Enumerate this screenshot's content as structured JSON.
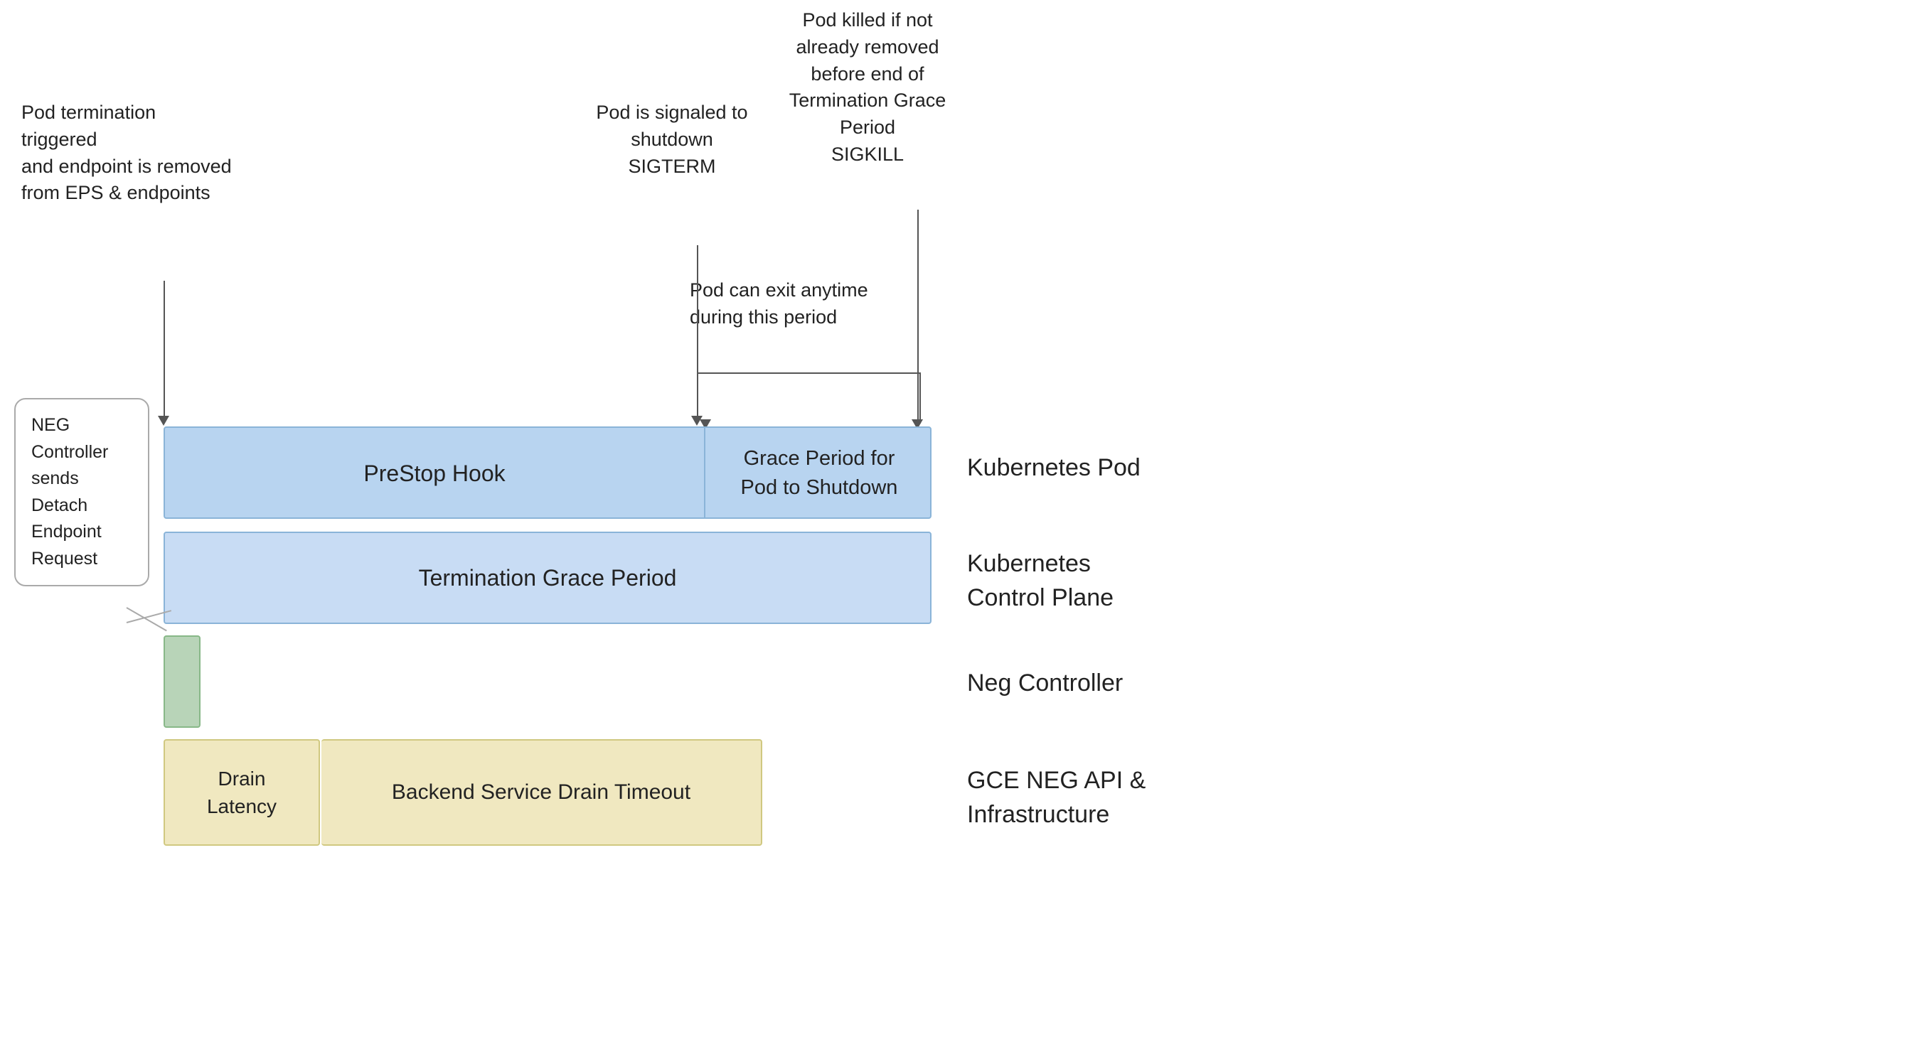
{
  "annotations": {
    "pod_termination": "Pod termination triggered\nand endpoint is removed\nfrom EPS & endpoints",
    "pod_signaled": "Pod is signaled to\nshutdown\nSIGTERM",
    "pod_killed": "Pod killed if not\nalready removed\nbefore end of\nTermination Grace\nPeriod\nSIGKILL",
    "pod_can_exit": "Pod can exit anytime\nduring this period",
    "grace_period_label": "Grace Period for\nPod to Shutdown",
    "prestop_hook_label": "PreStop Hook",
    "termination_grace_label": "Termination Grace Period",
    "drain_latency_label": "Drain\nLatency",
    "backend_drain_label": "Backend Service Drain Timeout"
  },
  "speech_bubble": {
    "text": "NEG\nController\nsends\nDetach\nEndpoint\nRequest"
  },
  "row_labels": {
    "kubernetes_pod": "Kubernetes Pod",
    "kubernetes_cp": "Kubernetes\nControl Plane",
    "neg_controller": "Neg Controller",
    "gce_neg": "GCE NEG API &\nInfrastructure"
  },
  "colors": {
    "pod_bar": "#b8d4f0",
    "grace_bar": "#a8c8ec",
    "termination_bar": "#c8dcf4",
    "neg_bar": "#b8d4b8",
    "drain_bar": "#f0e8c0",
    "border_blue": "#7aaad0",
    "text_dark": "#222222",
    "line_color": "#555555"
  }
}
